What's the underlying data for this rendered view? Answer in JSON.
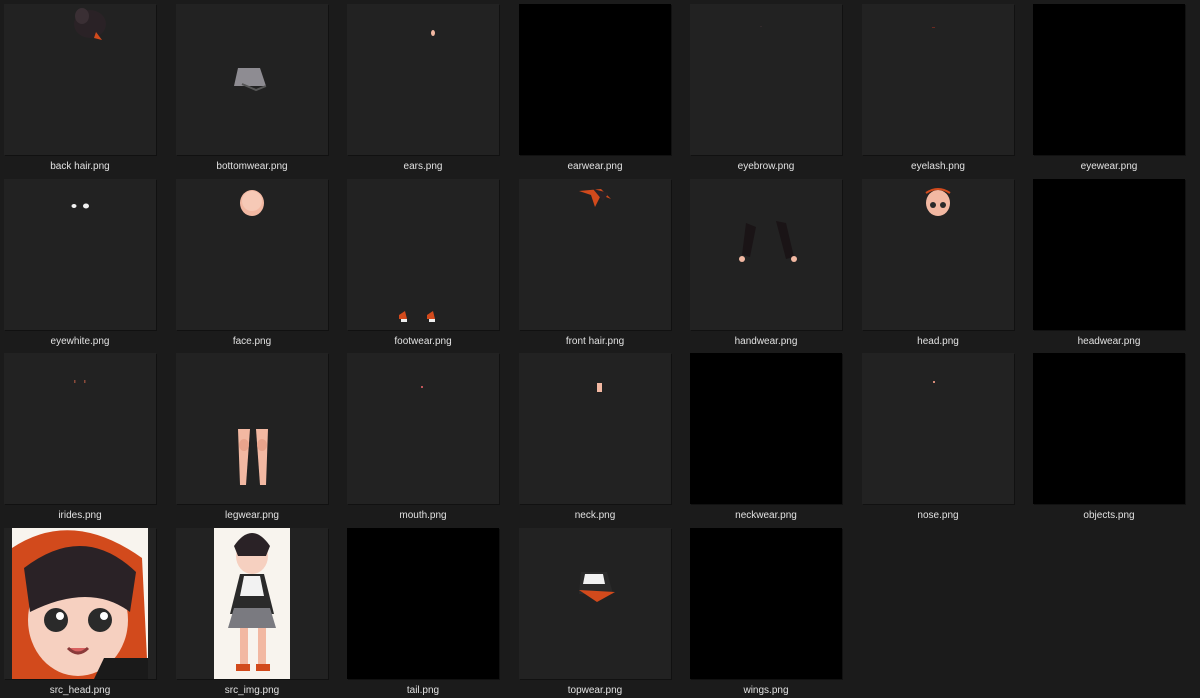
{
  "files": [
    {
      "name": "back hair.png",
      "icon": "back-hair-thumbnail",
      "thumb": "back-hair"
    },
    {
      "name": "bottomwear.png",
      "icon": "bottomwear-thumbnail",
      "thumb": "bottomwear"
    },
    {
      "name": "ears.png",
      "icon": "ears-thumbnail",
      "thumb": "ears"
    },
    {
      "name": "earwear.png",
      "icon": "earwear-thumbnail",
      "thumb": "black"
    },
    {
      "name": "eyebrow.png",
      "icon": "eyebrow-thumbnail",
      "thumb": "eyebrow"
    },
    {
      "name": "eyelash.png",
      "icon": "eyelash-thumbnail",
      "thumb": "eyelash"
    },
    {
      "name": "eyewear.png",
      "icon": "eyewear-thumbnail",
      "thumb": "black"
    },
    {
      "name": "eyewhite.png",
      "icon": "eyewhite-thumbnail",
      "thumb": "eyewhite"
    },
    {
      "name": "face.png",
      "icon": "face-thumbnail",
      "thumb": "face"
    },
    {
      "name": "footwear.png",
      "icon": "footwear-thumbnail",
      "thumb": "footwear"
    },
    {
      "name": "front hair.png",
      "icon": "front-hair-thumbnail",
      "thumb": "front-hair"
    },
    {
      "name": "handwear.png",
      "icon": "handwear-thumbnail",
      "thumb": "handwear"
    },
    {
      "name": "head.png",
      "icon": "head-thumbnail",
      "thumb": "head"
    },
    {
      "name": "headwear.png",
      "icon": "headwear-thumbnail",
      "thumb": "black"
    },
    {
      "name": "irides.png",
      "icon": "irides-thumbnail",
      "thumb": "irides"
    },
    {
      "name": "legwear.png",
      "icon": "legwear-thumbnail",
      "thumb": "legwear"
    },
    {
      "name": "mouth.png",
      "icon": "mouth-thumbnail",
      "thumb": "mouth"
    },
    {
      "name": "neck.png",
      "icon": "neck-thumbnail",
      "thumb": "neck"
    },
    {
      "name": "neckwear.png",
      "icon": "neckwear-thumbnail",
      "thumb": "black"
    },
    {
      "name": "nose.png",
      "icon": "nose-thumbnail",
      "thumb": "nose"
    },
    {
      "name": "objects.png",
      "icon": "objects-thumbnail",
      "thumb": "black"
    },
    {
      "name": "src_head.png",
      "icon": "src-head-thumbnail",
      "thumb": "src-head"
    },
    {
      "name": "src_img.png",
      "icon": "src-img-thumbnail",
      "thumb": "src-img"
    },
    {
      "name": "tail.png",
      "icon": "tail-thumbnail",
      "thumb": "black"
    },
    {
      "name": "topwear.png",
      "icon": "topwear-thumbnail",
      "thumb": "topwear"
    },
    {
      "name": "wings.png",
      "icon": "wings-thumbnail",
      "thumb": "black"
    }
  ],
  "colors": {
    "background": "#1b1b1b",
    "thumb_bg": "#222222",
    "label_text": "#e2e2e2",
    "hair_dark": "#2a2226",
    "hair_orange": "#d24a1c",
    "skin": "#f2b8a2"
  }
}
